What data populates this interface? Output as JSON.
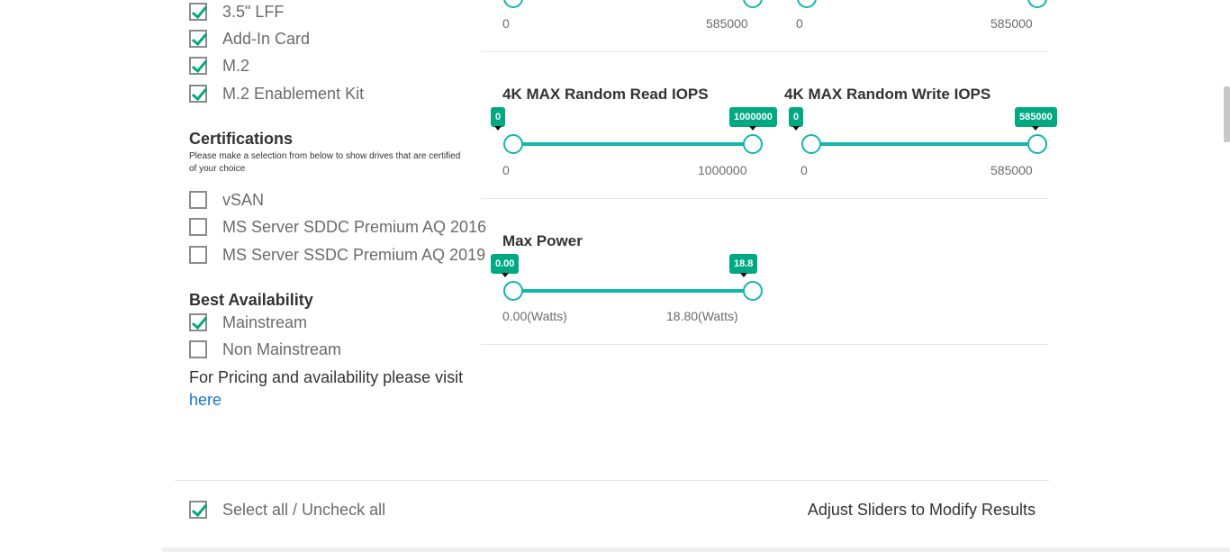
{
  "form_factor": {
    "items": [
      {
        "label": "3.5\" LFF",
        "checked": true
      },
      {
        "label": "Add-In Card",
        "checked": true
      },
      {
        "label": "M.2",
        "checked": true
      },
      {
        "label": "M.2 Enablement Kit",
        "checked": true
      }
    ]
  },
  "certifications": {
    "title": "Certifications",
    "note": "Please make a selection from below to show drives that are certified of your choice",
    "items": [
      {
        "label": "vSAN",
        "checked": false
      },
      {
        "label": "MS Server SDDC Premium AQ 2016",
        "checked": false
      },
      {
        "label": "MS Server SSDC Premium AQ 2019",
        "checked": false
      }
    ]
  },
  "availability": {
    "title": "Best Availability",
    "items": [
      {
        "label": "Mainstream",
        "checked": true
      },
      {
        "label": "Non Mainstream",
        "checked": false
      }
    ],
    "pricing_text": "For Pricing and availability please visit",
    "link_text": "here"
  },
  "sliders": {
    "top_left": {
      "min_label": "0",
      "max_label": "585000"
    },
    "top_right": {
      "min_label": "0",
      "max_label": "585000"
    },
    "read_iops": {
      "title": "4K MAX Random Read IOPS",
      "low": "0",
      "high": "1000000",
      "min_label": "0",
      "max_label": "1000000"
    },
    "write_iops": {
      "title": "4K MAX Random Write IOPS",
      "low": "0",
      "high": "585000",
      "min_label": "0",
      "max_label": "585000"
    },
    "max_power": {
      "title": "Max Power",
      "low": "0.00",
      "high": "18.8",
      "min_label": "0.00(Watts)",
      "max_label": "18.80(Watts)"
    }
  },
  "footer": {
    "select_all_label": "Select all / Uncheck all",
    "select_all_checked": true,
    "adjust_text": "Adjust Sliders to Modify Results"
  },
  "colors": {
    "accent": "#01a982",
    "track": "#13b6ad",
    "link": "#1a75ce"
  }
}
